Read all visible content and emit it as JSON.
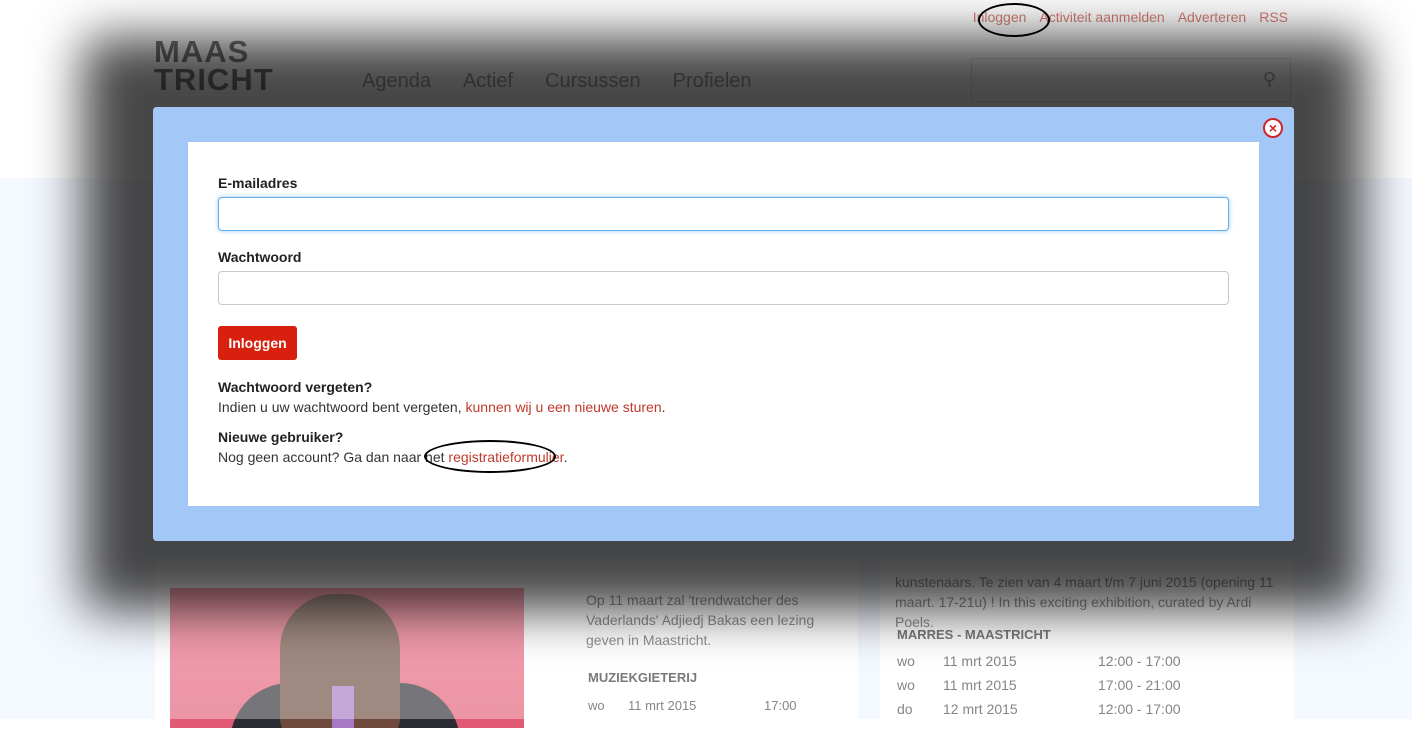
{
  "top_links": [
    "Inloggen",
    "Activiteit aanmelden",
    "Adverteren",
    "RSS"
  ],
  "logo": {
    "line1": "MAAS",
    "line2": "TRICHT"
  },
  "main_nav": [
    "Agenda",
    "Actief",
    "Cursussen",
    "Profielen"
  ],
  "background": {
    "card_left_text": "Op 11 maart zal 'trendwatcher des Vaderlands' Adjiedj Bakas een lezing geven in Maastricht.",
    "card_left_venue": "MUZIEKGIETERIJ",
    "card_left_row": {
      "day": "wo",
      "date": "11 mrt 2015",
      "time": "17:00"
    },
    "card_right_text": "kunstenaars. Te zien van 4 maart t/m 7 juni 2015 (opening 11 maart. 17-21u) ! In this exciting exhibition, curated by Ardi Poels.",
    "card_right_venue": "MARRES - MAASTRICHT",
    "card_right_rows": [
      {
        "day": "wo",
        "date": "11 mrt 2015",
        "time": "12:00 - 17:00"
      },
      {
        "day": "wo",
        "date": "11 mrt 2015",
        "time": "17:00 - 21:00"
      },
      {
        "day": "do",
        "date": "12 mrt 2015",
        "time": "12:00 - 17:00"
      }
    ]
  },
  "modal": {
    "email_label": "E-mailadres",
    "email_value": "",
    "password_label": "Wachtwoord",
    "password_value": "",
    "login_button": "Inloggen",
    "forgot_title": "Wachtwoord vergeten?",
    "forgot_text": "Indien u uw wachtwoord bent vergeten, ",
    "forgot_link": "kunnen wij u een nieuwe sturen",
    "forgot_end": ".",
    "new_user_title": "Nieuwe gebruiker?",
    "new_user_text": "Nog geen account? Ga dan naar het ",
    "new_user_link": "registratieformulier",
    "new_user_end": ".",
    "close_icon": "close-icon",
    "close_symbol": "×"
  },
  "colors": {
    "accent": "#d7200d",
    "link": "#c0392b",
    "modal_frame": "#a3c8f8",
    "band": "#eef4ff"
  }
}
